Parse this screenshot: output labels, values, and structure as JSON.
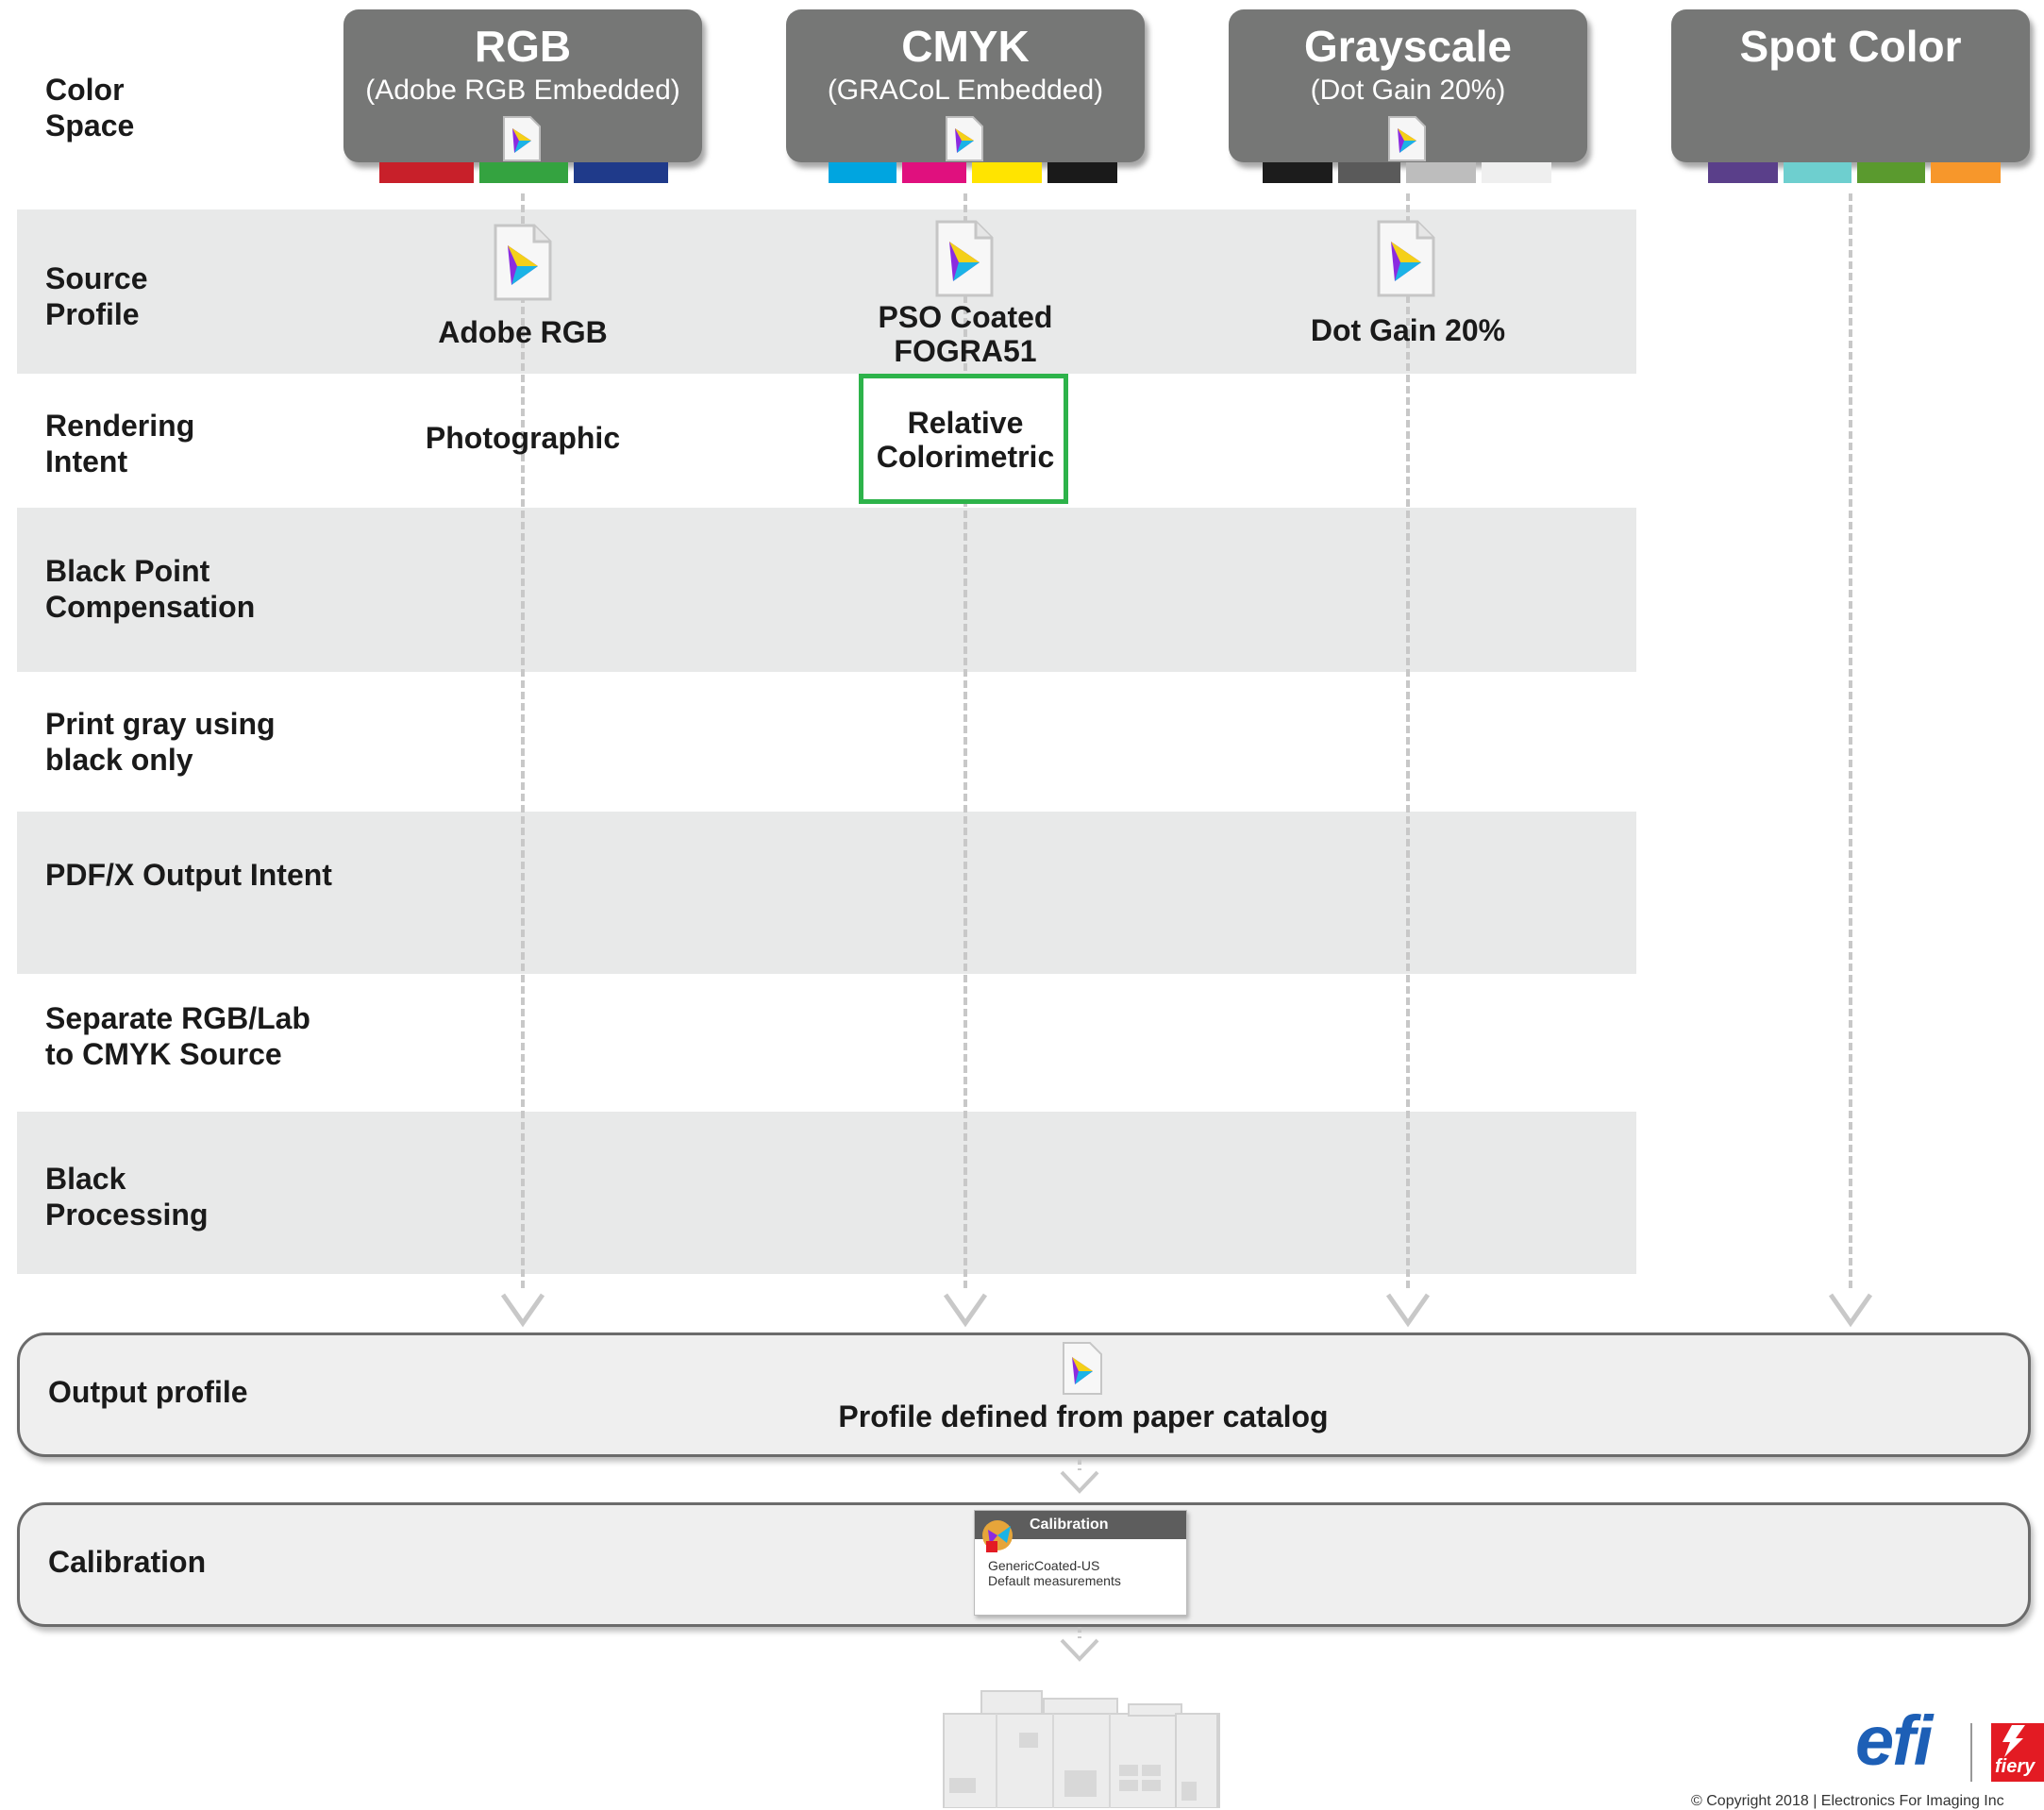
{
  "rows": [
    {
      "label": "Color\nSpace"
    },
    {
      "label": "Source\nProfile"
    },
    {
      "label": "Rendering\nIntent"
    },
    {
      "label": "Black Point\nCompensation"
    },
    {
      "label": "Print gray using\nblack only"
    },
    {
      "label": "PDF/X Output Intent"
    },
    {
      "label": "Separate RGB/Lab\nto CMYK Source"
    },
    {
      "label": "Black\nProcessing"
    }
  ],
  "color_spaces": [
    {
      "title": "RGB",
      "subtitle": "(Adobe RGB Embedded)",
      "swatches": [
        "#c8202a",
        "#34a340",
        "#1f3a8a"
      ]
    },
    {
      "title": "CMYK",
      "subtitle": "(GRACoL Embedded)",
      "swatches": [
        "#00a5e0",
        "#e0107e",
        "#ffe400",
        "#1a1a1a"
      ]
    },
    {
      "title": "Grayscale",
      "subtitle": "(Dot Gain 20%)",
      "swatches": [
        "#1c1c1c",
        "#5a5a5a",
        "#bdbdbd",
        "#efefef"
      ]
    },
    {
      "title": "Spot Color",
      "subtitle": "",
      "swatches": [
        "#5a3f8a",
        "#6ecfcf",
        "#5a9a2e",
        "#f7972b"
      ]
    }
  ],
  "source_profiles": [
    "Adobe RGB",
    "PSO Coated\nFOGRA51",
    "Dot Gain 20%"
  ],
  "rendering_intents": [
    "Photographic",
    "Relative\nColorimetric"
  ],
  "output_profile": {
    "label": "Output profile",
    "value": "Profile defined from paper catalog"
  },
  "calibration": {
    "label": "Calibration",
    "card_title": "Calibration",
    "card_text": "GenericCoated-US\nDefault measurements"
  },
  "brand": {
    "efi": "efi",
    "fiery": "fiery"
  },
  "copyright": "© Copyright 2018 | Electronics For Imaging Inc",
  "colors": {
    "band": "#e8e9e9",
    "box": "#767776",
    "highlight": "#2db34a",
    "dash": "#c8c8c8",
    "efi_blue": "#1d5fb6",
    "fiery_red": "#e31b23"
  }
}
